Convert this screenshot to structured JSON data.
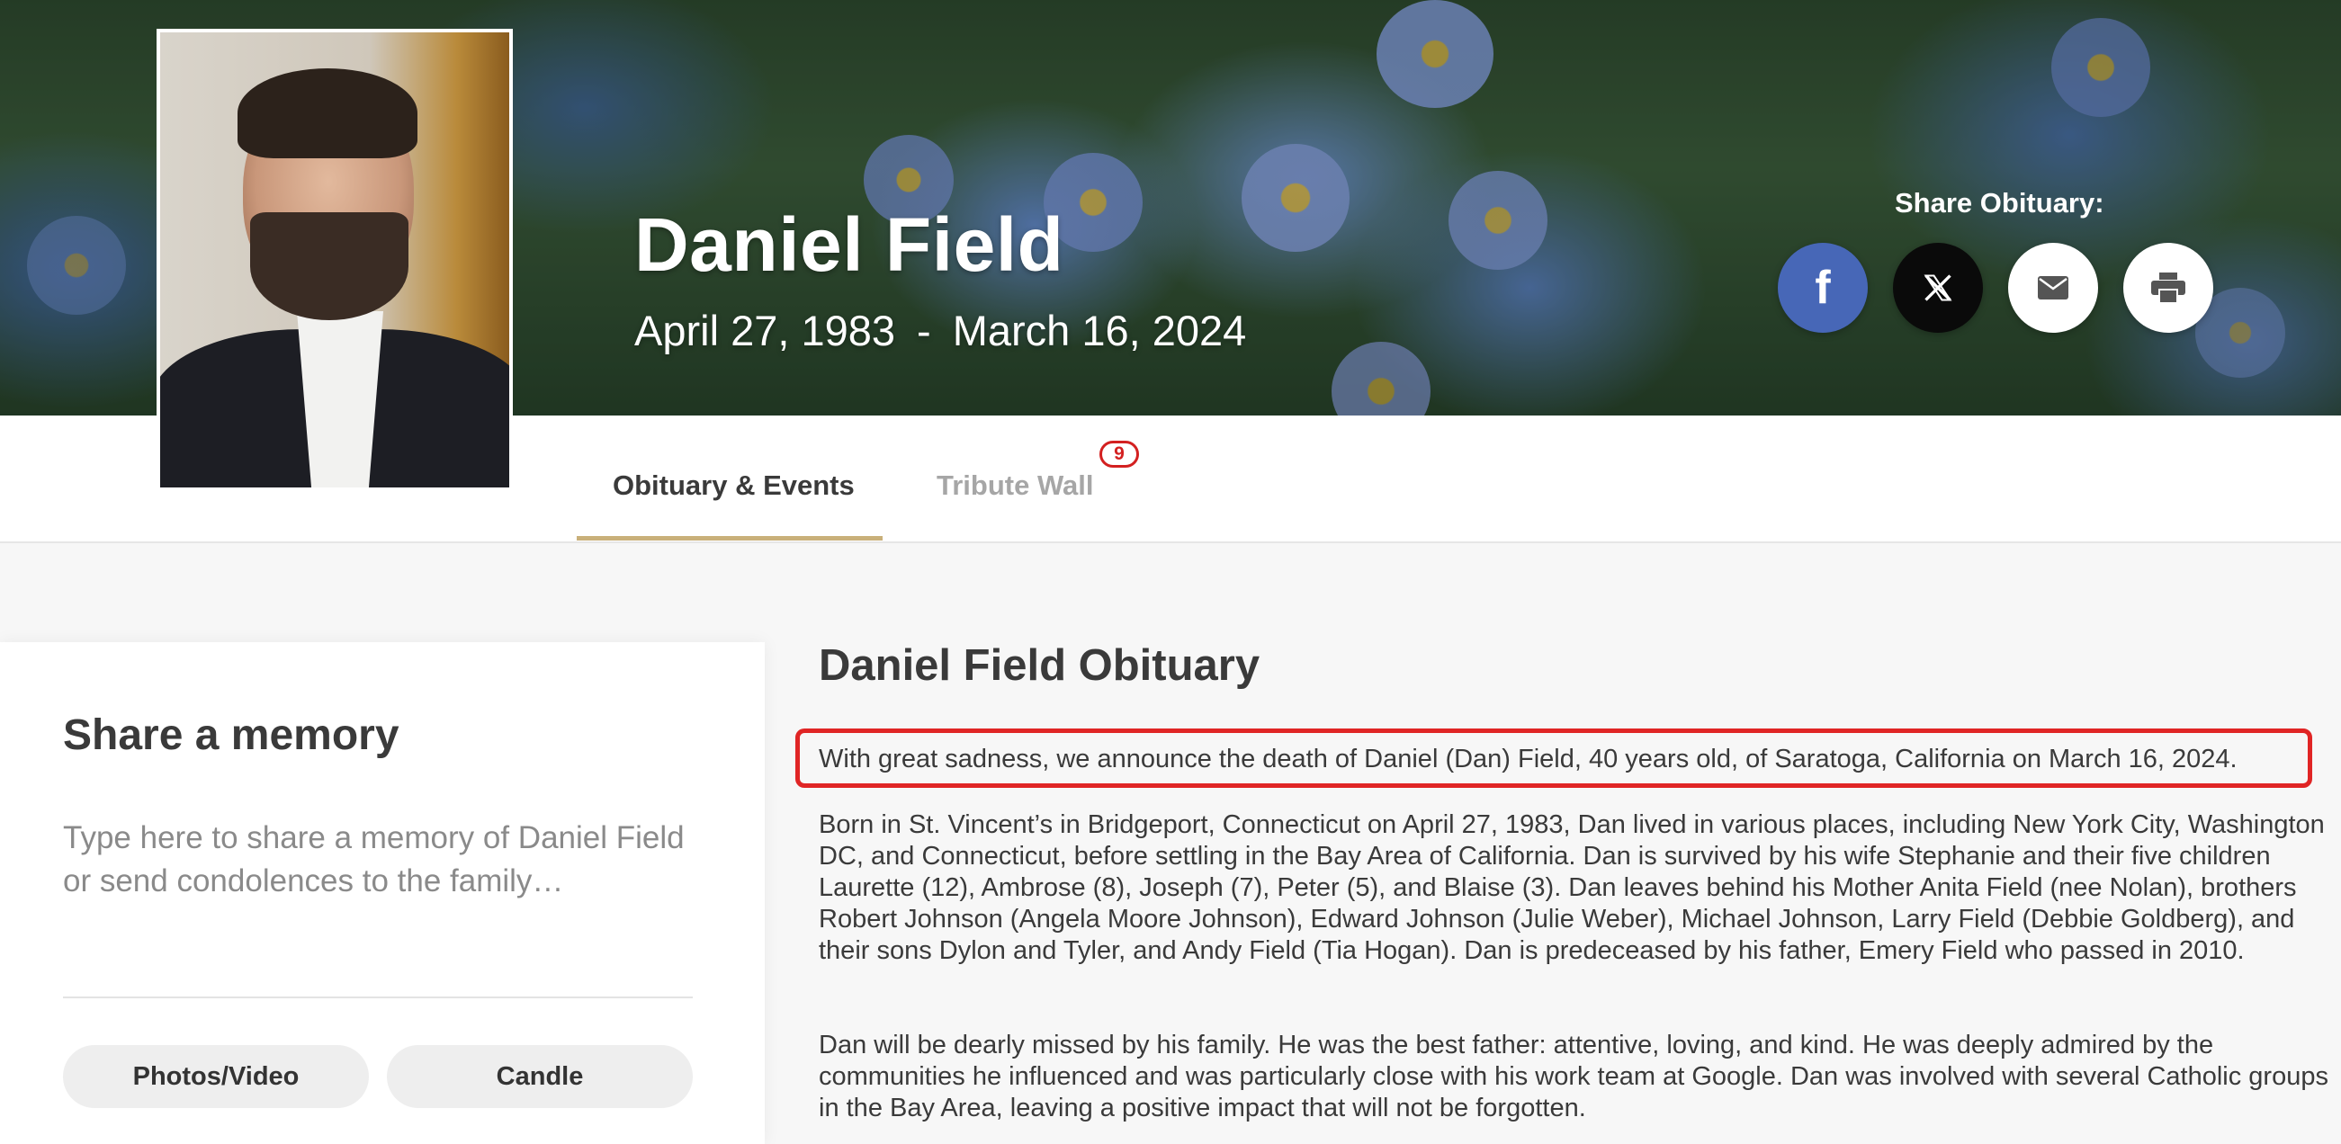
{
  "hero": {
    "name": "Daniel Field",
    "birth_date": "April 27, 1983",
    "date_separator": "-",
    "death_date": "March 16, 2024",
    "share_label": "Share Obituary:",
    "share_buttons": [
      {
        "id": "facebook",
        "icon": "facebook-icon",
        "glyph": "f",
        "color": "#4767b7"
      },
      {
        "id": "x",
        "icon": "x-icon",
        "color": "#0a0a0a"
      },
      {
        "id": "email",
        "icon": "mail-icon",
        "color": "#ffffff"
      },
      {
        "id": "print",
        "icon": "print-icon",
        "color": "#ffffff"
      }
    ]
  },
  "tabs": [
    {
      "label": "Obituary & Events",
      "active": true
    },
    {
      "label": "Tribute Wall",
      "active": false,
      "badge": "9"
    }
  ],
  "memory": {
    "title": "Share a memory",
    "placeholder": "Type here to share a memory of Daniel Field or send condolences to the family…",
    "buttons": [
      "Photos/Video",
      "Candle"
    ]
  },
  "obituary": {
    "title": "Daniel Field Obituary",
    "lead": "With great sadness, we announce the death of Daniel (Dan) Field, 40 years old, of Saratoga, California on March 16, 2024.",
    "paragraphs": [
      "Born in St. Vincent’s in Bridgeport, Connecticut on April 27, 1983, Dan lived in various places, including New York City, Washington DC, and Connecticut, before settling in the Bay Area of California. Dan is survived by his wife Stephanie and their five children Laurette (12), Ambrose (8), Joseph (7), Peter (5), and Blaise (3). Dan leaves behind his Mother Anita Field (nee Nolan), brothers Robert Johnson (Angela Moore Johnson), Edward Johnson (Julie Weber), Michael Johnson, Larry Field (Debbie Goldberg), and their sons Dylon and Tyler, and Andy Field (Tia Hogan). Dan is predeceased by his father, Emery Field who passed in 2010.",
      "Dan will be dearly missed by his family. He was the best father: attentive, loving, and kind. He was deeply admired by the communities he influenced and was particularly close with his work team at Google. Dan was involved with several Catholic groups in the Bay Area, leaving a positive impact that will not be forgotten."
    ]
  },
  "colors": {
    "tab_underline": "#c9b07a",
    "badge": "#d32020",
    "highlight": "#e02525"
  }
}
